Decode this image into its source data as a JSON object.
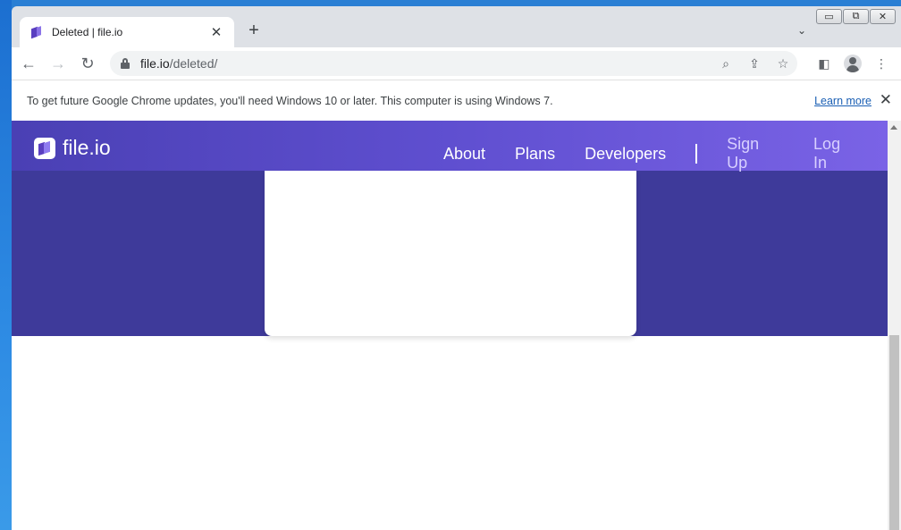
{
  "browser": {
    "tab": {
      "title": "Deleted | file.io",
      "close_label": "✕"
    },
    "new_tab_label": "+",
    "tab_search_label": "⌄",
    "url_host": "file.io",
    "url_path": "/deleted/",
    "infobar": {
      "message": "To get future Google Chrome updates, you'll need Windows 10 or later. This computer is using Windows 7.",
      "link": "Learn more",
      "close_label": "✕"
    },
    "caption": {
      "minimize": "▭",
      "restore": "⧉",
      "close": "✕"
    },
    "icons": {
      "back": "←",
      "forward": "→",
      "reload": "↻",
      "zoom": "⌕",
      "share": "⇪",
      "bookmark": "☆",
      "sidepanel": "◧",
      "menu": "⋮"
    }
  },
  "site": {
    "logo_text": "file.io",
    "nav": [
      {
        "label": "About"
      },
      {
        "label": "Plans"
      },
      {
        "label": "Developers"
      }
    ],
    "auth": [
      {
        "label": "Sign Up"
      },
      {
        "label": "Log In"
      }
    ],
    "colors": {
      "hero": "#3e3a9a",
      "header_start": "#4a40b4",
      "header_end": "#7a63e6"
    }
  }
}
